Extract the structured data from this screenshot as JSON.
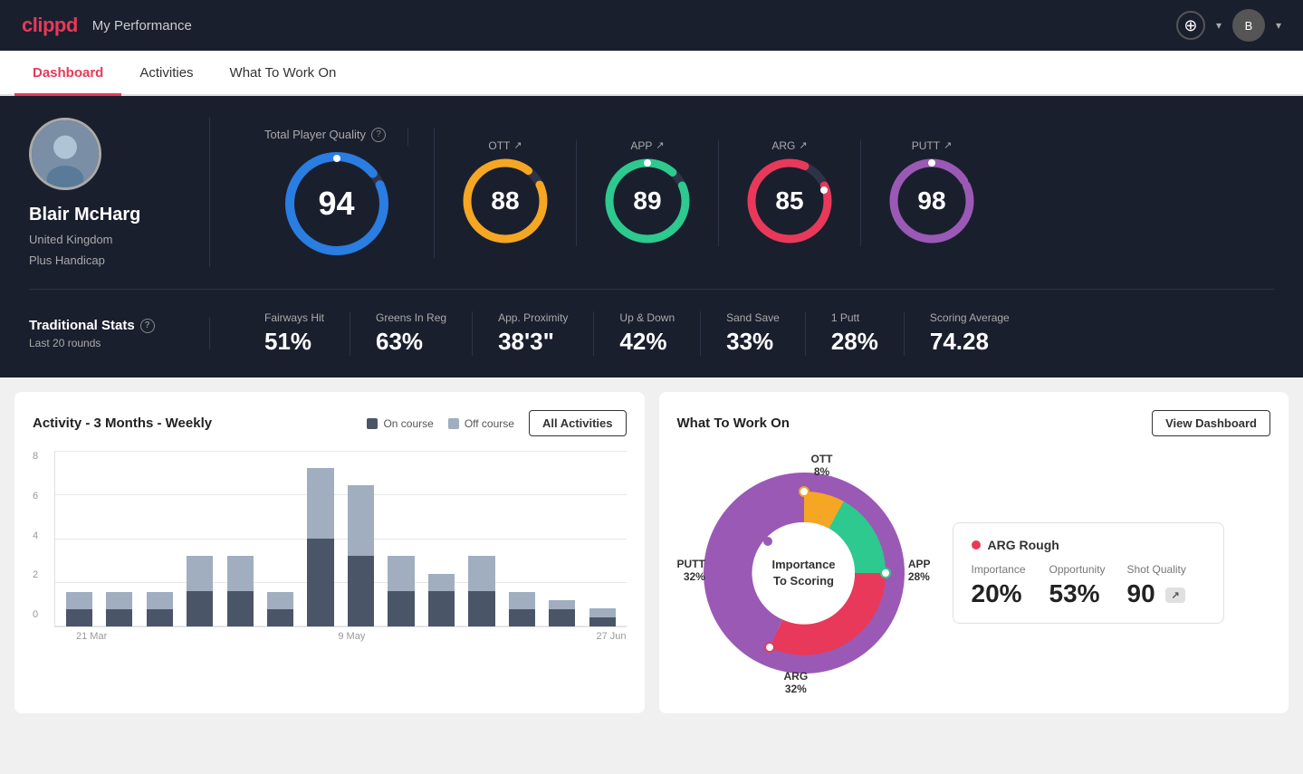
{
  "header": {
    "logo": "clippd",
    "title": "My Performance",
    "add_icon": "+",
    "dropdown_icon": "▾",
    "avatar_text": "B"
  },
  "tabs": [
    {
      "id": "dashboard",
      "label": "Dashboard",
      "active": true
    },
    {
      "id": "activities",
      "label": "Activities",
      "active": false
    },
    {
      "id": "what-to-work-on",
      "label": "What To Work On",
      "active": false
    }
  ],
  "player": {
    "name": "Blair McHarg",
    "country": "United Kingdom",
    "handicap": "Plus Handicap"
  },
  "quality": {
    "section_label": "Total Player Quality",
    "main": {
      "value": "94",
      "color": "#2a7de1"
    },
    "metrics": [
      {
        "id": "OTT",
        "label": "OTT",
        "value": "88",
        "color": "#f5a623"
      },
      {
        "id": "APP",
        "label": "APP",
        "value": "89",
        "color": "#2dc98e"
      },
      {
        "id": "ARG",
        "label": "ARG",
        "value": "85",
        "color": "#e8395a"
      },
      {
        "id": "PUTT",
        "label": "PUTT",
        "value": "98",
        "color": "#9b59b6"
      }
    ]
  },
  "stats": {
    "title": "Traditional Stats",
    "subtitle": "Last 20 rounds",
    "items": [
      {
        "label": "Fairways Hit",
        "value": "51%"
      },
      {
        "label": "Greens In Reg",
        "value": "63%"
      },
      {
        "label": "App. Proximity",
        "value": "38'3\""
      },
      {
        "label": "Up & Down",
        "value": "42%"
      },
      {
        "label": "Sand Save",
        "value": "33%"
      },
      {
        "label": "1 Putt",
        "value": "28%"
      },
      {
        "label": "Scoring Average",
        "value": "74.28"
      }
    ]
  },
  "activity_chart": {
    "title": "Activity - 3 Months - Weekly",
    "legend": [
      {
        "label": "On course",
        "color": "#4a5568"
      },
      {
        "label": "Off course",
        "color": "#a0aec0"
      }
    ],
    "all_activities_btn": "All Activities",
    "y_labels": [
      "8",
      "6",
      "4",
      "2",
      "0"
    ],
    "x_labels": [
      "21 Mar",
      "9 May",
      "27 Jun"
    ],
    "bars": [
      {
        "on": 1,
        "off": 1
      },
      {
        "on": 1,
        "off": 1
      },
      {
        "on": 1,
        "off": 1
      },
      {
        "on": 2,
        "off": 2
      },
      {
        "on": 2,
        "off": 2
      },
      {
        "on": 1,
        "off": 1
      },
      {
        "on": 5,
        "off": 4
      },
      {
        "on": 4,
        "off": 4
      },
      {
        "on": 2,
        "off": 2
      },
      {
        "on": 2,
        "off": 1
      },
      {
        "on": 2,
        "off": 2
      },
      {
        "on": 1,
        "off": 1
      },
      {
        "on": 1,
        "off": 0.5
      },
      {
        "on": 0.5,
        "off": 0.5
      }
    ]
  },
  "what_to_work_on": {
    "title": "What To Work On",
    "view_dashboard_btn": "View Dashboard",
    "donut_center_line1": "Importance",
    "donut_center_line2": "To Scoring",
    "segments": [
      {
        "label": "OTT",
        "percent": "8%",
        "color": "#f5a623"
      },
      {
        "label": "APP",
        "percent": "28%",
        "color": "#2dc98e"
      },
      {
        "label": "ARG",
        "percent": "32%",
        "color": "#e8395a"
      },
      {
        "label": "PUTT",
        "percent": "32%",
        "color": "#9b59b6"
      }
    ],
    "info_card": {
      "title": "ARG Rough",
      "dot_color": "#e8395a",
      "metrics": [
        {
          "label": "Importance",
          "value": "20%"
        },
        {
          "label": "Opportunity",
          "value": "53%"
        },
        {
          "label": "Shot Quality",
          "value": "90",
          "badge": "↗"
        }
      ]
    }
  }
}
